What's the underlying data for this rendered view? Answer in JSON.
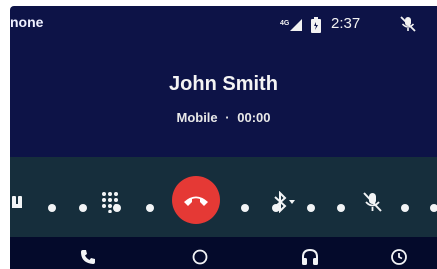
{
  "status_bar": {
    "app_label": "none",
    "network": "4G",
    "time": "2:37",
    "icons": [
      "signal-icon",
      "battery-icon",
      "mic-muted-icon"
    ]
  },
  "call": {
    "caller_name": "John Smith",
    "line_type": "Mobile",
    "separator": "·",
    "duration": "00:00"
  },
  "controls": {
    "buttons": [
      "audio-output",
      "dialpad",
      "end-call",
      "bluetooth-audio",
      "mute"
    ],
    "end_call_color": "#e53935"
  },
  "nav": {
    "items": [
      "phone",
      "home",
      "music",
      "notifications"
    ]
  },
  "colors": {
    "background": "#0d1347",
    "panel": "#162e3c",
    "navbar": "#040a2b"
  }
}
